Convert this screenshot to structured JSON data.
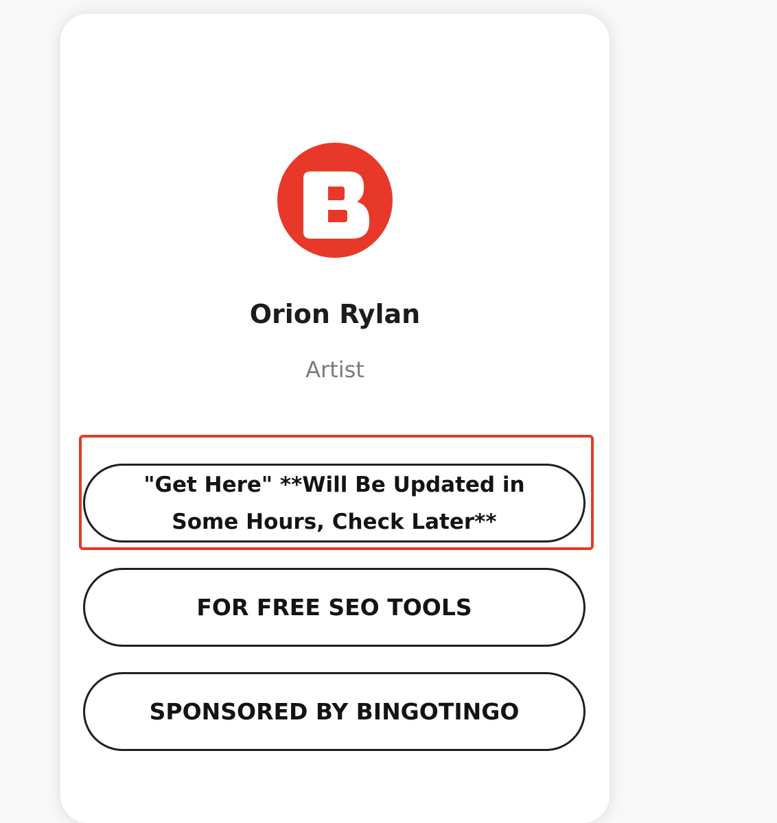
{
  "profile": {
    "logo_letter": "B",
    "name": "Orion Rylan",
    "role": "Artist"
  },
  "links": [
    {
      "label": "\"Get Here\" **Will Be Updated in Some Hours, Check Later**"
    },
    {
      "label": "FOR FREE SEO TOOLS"
    },
    {
      "label": "SPONSORED BY BINGOTINGO"
    }
  ],
  "colors": {
    "logo_red": "#e8382a",
    "highlight_border": "#e23a2c",
    "page_background": "#f8f8f8"
  },
  "icons": {
    "logo": "bingotingo-b-logo"
  }
}
